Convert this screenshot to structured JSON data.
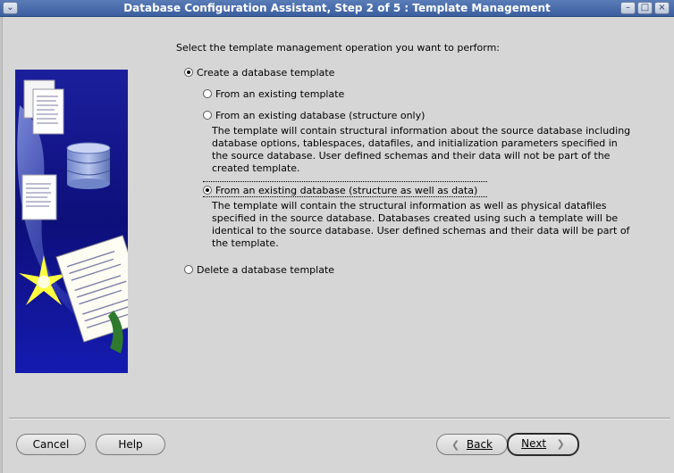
{
  "window": {
    "title": "Database Configuration Assistant, Step 2 of 5 : Template Management"
  },
  "content": {
    "prompt": "Select the template management operation you want to perform:",
    "options": {
      "create": "Create a database template",
      "from_template": "From an existing template",
      "from_db_structure": "From an existing database (structure only)",
      "from_db_structure_desc_1": "The template will contain structural information about the source database including",
      "from_db_structure_desc_2": "database options, tablespaces, datafiles, and initialization parameters specified in",
      "from_db_structure_desc_3": "the source database. User defined schemas and their data will not be part of the",
      "from_db_structure_desc_4": "created template.",
      "from_db_full": "From an existing database (structure as well as data)",
      "from_db_full_desc_1": "The template will contain the structural information as well as physical datafiles",
      "from_db_full_desc_2": "specified in the source database. Databases created using such a template will be",
      "from_db_full_desc_3": "identical to the source database. User defined schemas and their data will be part of",
      "from_db_full_desc_4": "the template.",
      "delete": "Delete a database template"
    },
    "selected": "create"
  },
  "buttons": {
    "cancel": "Cancel",
    "help": "Help",
    "back": "Back",
    "next": "Next"
  }
}
